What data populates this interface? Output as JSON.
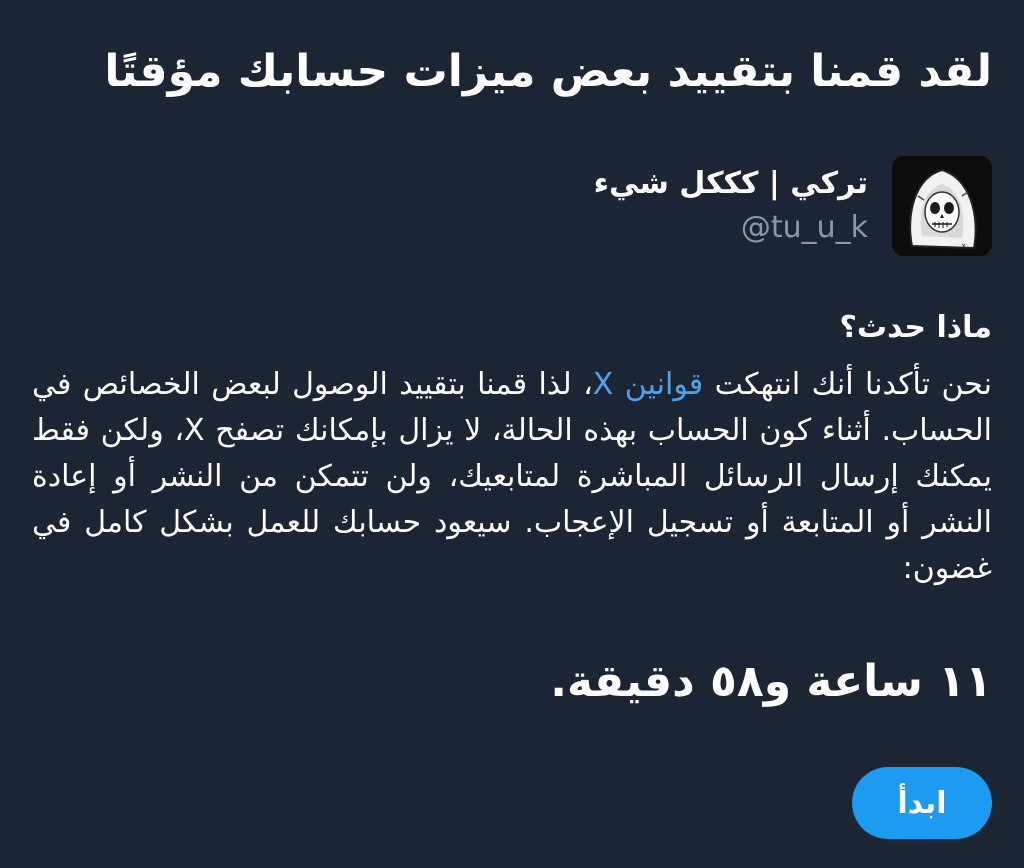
{
  "header": {
    "title": "لقد قمنا بتقييد بعض ميزات حسابك مؤقتًا"
  },
  "account": {
    "display_name": "تركي | كككل شيء",
    "handle": "@tu_u_k",
    "avatar_icon": "skull-hoodie-avatar"
  },
  "details": {
    "heading": "ماذا حدث؟",
    "text_before_link": "نحن تأكدنا أنك انتهكت ",
    "link_text": "قوانين X",
    "text_after_link": "، لذا قمنا بتقييد الوصول لبعض الخصائص في الحساب. أثناء كون الحساب بهذه الحالة، لا يزال بإمكانك تصفح X، ولكن فقط يمكنك إرسال الرسائل المباشرة لمتابعيك، ولن تتمكن من النشر أو إعادة النشر أو المتابعة أو تسجيل الإعجاب. سيعود حسابك للعمل بشكل كامل في غضون:"
  },
  "countdown": {
    "text": "١١ ساعة و٥٨ دقيقة."
  },
  "actions": {
    "start_label": "ابدأ"
  },
  "colors": {
    "background": "#1b2533",
    "link": "#4ea1ec",
    "button": "#1d9bf0",
    "secondary_text": "#8b98a5"
  }
}
